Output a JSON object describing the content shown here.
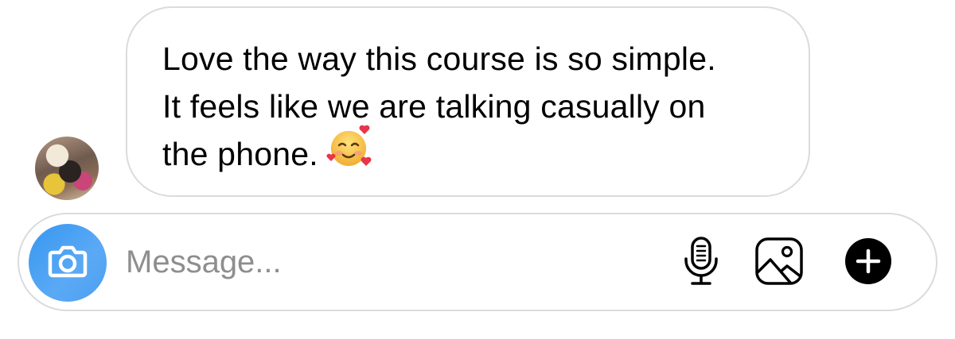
{
  "message": {
    "lines": [
      "Love the way this course is so simple.",
      "It feels like we are talking casually on",
      "the phone."
    ],
    "emoji": "smiling-face-with-hearts"
  },
  "composer": {
    "placeholder": "Message...",
    "value": ""
  },
  "icons": {
    "camera": "camera-icon",
    "microphone": "microphone-icon",
    "gallery": "gallery-icon",
    "plus": "plus-icon"
  },
  "colors": {
    "camera_button": "#3797f0",
    "border": "#dbdbdb",
    "placeholder": "#8e8e8e",
    "text": "#000000"
  }
}
